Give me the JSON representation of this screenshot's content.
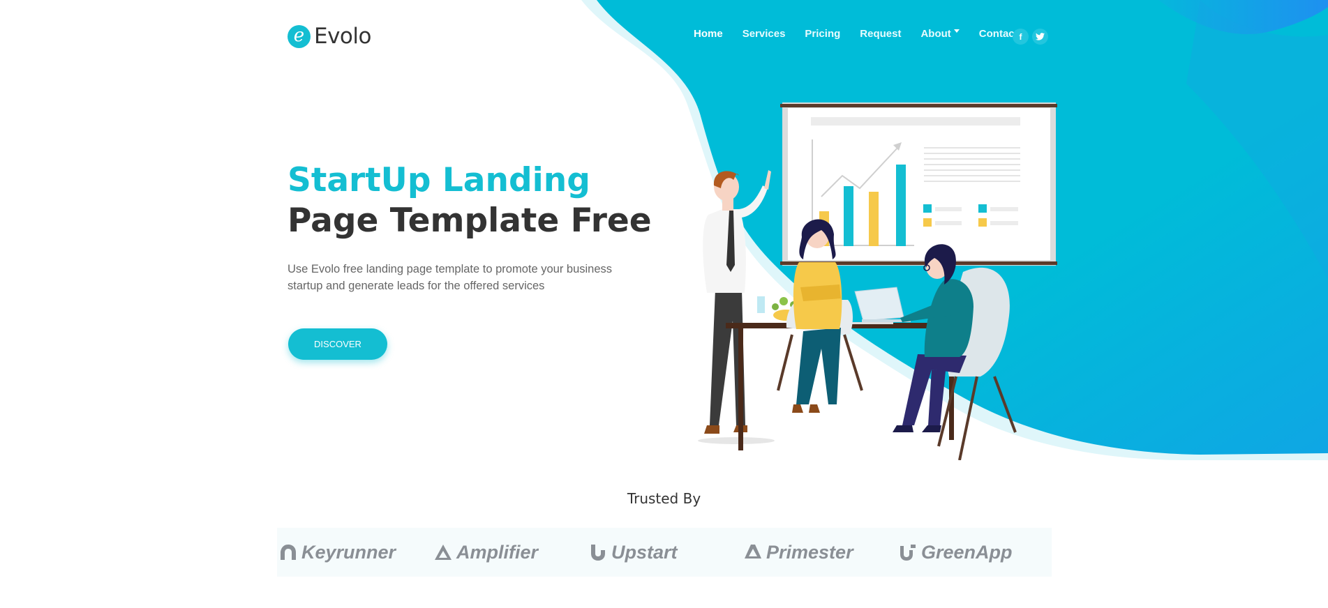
{
  "brand": {
    "logo_letter": "e",
    "name": "Evolo"
  },
  "nav": {
    "items": [
      {
        "label": "Home",
        "active": true
      },
      {
        "label": "Services"
      },
      {
        "label": "Pricing"
      },
      {
        "label": "Request"
      },
      {
        "label": "About",
        "has_dropdown": true
      },
      {
        "label": "Contact"
      }
    ],
    "socials": [
      {
        "icon": "facebook-icon",
        "glyph": "f"
      },
      {
        "icon": "twitter-icon",
        "glyph": "t"
      }
    ]
  },
  "hero": {
    "title_line1": "StartUp Landing",
    "title_line2": "Page Template Free",
    "description": "Use Evolo free landing page template to promote your business startup and generate leads for the offered services",
    "cta_label": "DISCOVER"
  },
  "trusted": {
    "title": "Trusted By",
    "brands": [
      {
        "name": "Keyrunner",
        "icon": "keyrunner-logo-icon"
      },
      {
        "name": "Amplifier",
        "icon": "amplifier-logo-icon"
      },
      {
        "name": "Upstart",
        "icon": "upstart-logo-icon"
      },
      {
        "name": "Primester",
        "icon": "primester-logo-icon"
      },
      {
        "name": "GreenApp",
        "icon": "greenapp-logo-icon"
      }
    ]
  },
  "colors": {
    "accent": "#14bed2",
    "heading": "#333333",
    "hero_gradient_start": "#00bcd8",
    "hero_gradient_end": "#1e90f0"
  }
}
